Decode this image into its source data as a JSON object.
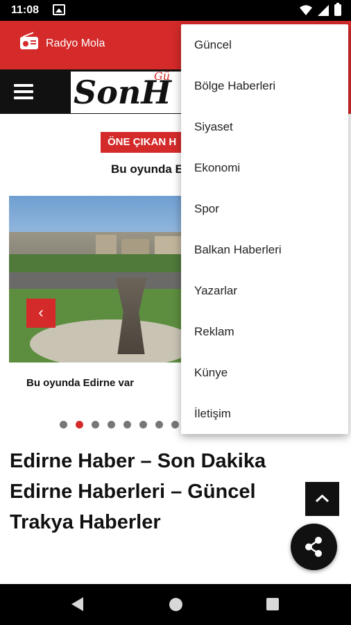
{
  "status_bar": {
    "time": "11:08"
  },
  "radio": {
    "label": "Radyo Mola"
  },
  "logo": {
    "text": "SonH",
    "tagline": "Gü"
  },
  "featured": {
    "badge": "ÖNE ÇIKAN H",
    "title": "Bu oyunda E",
    "caption": "Bu oyunda Edirne var"
  },
  "slider": {
    "prev_label": "‹",
    "dot_count": 8,
    "active_dot": 2
  },
  "page_heading": "Edirne Haber – Son Dakika Edirne Haberleri – Güncel Trakya Haberler",
  "colors": {
    "accent": "#d42a2a",
    "dark": "#111111"
  },
  "menu": {
    "items": [
      {
        "label": "Güncel"
      },
      {
        "label": "Bölge Haberleri"
      },
      {
        "label": "Siyaset"
      },
      {
        "label": "Ekonomi"
      },
      {
        "label": "Spor"
      },
      {
        "label": "Balkan Haberleri"
      },
      {
        "label": "Yazarlar"
      },
      {
        "label": "Reklam"
      },
      {
        "label": "Künye"
      },
      {
        "label": "İletişim"
      }
    ]
  },
  "icons": {
    "notification": "notification-icon",
    "wifi": "wifi-icon",
    "signal": "signal-icon",
    "battery": "battery-icon",
    "radio": "radio-icon",
    "menu": "hamburger-menu-icon",
    "scroll_top": "chevron-up-icon",
    "share": "share-icon",
    "back": "back-icon",
    "home": "home-icon",
    "recent": "recent-apps-icon"
  }
}
